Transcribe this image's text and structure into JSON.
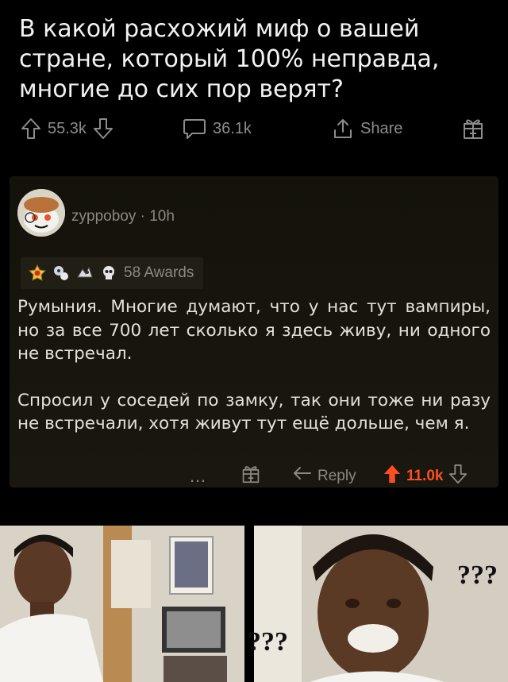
{
  "question": {
    "lines": [
      "В какой расхожий миф о вашей",
      "стране, который 100% неправда,",
      "многие до сих пор верят?"
    ]
  },
  "postbar": {
    "upvotes": "55.3k",
    "comments": "36.1k",
    "share_label": "Share"
  },
  "comment": {
    "author": "zyppoboy",
    "time": "10h",
    "awards_label": "58 Awards",
    "paragraphs": [
      "Румыния. Многие думают, что у нас тут вампиры, но за все 700 лет сколько я здесь живу, ни одного не встречал.",
      "Спросил у соседей по замку, так они тоже ни разу не встречали, хотя живут тут ещё дольше, чем я."
    ],
    "actions": {
      "more_label": "…",
      "reply_label": "Reply",
      "score": "11.0k"
    }
  },
  "meme": {
    "left_caption": "???",
    "right_caption": "???"
  },
  "colors": {
    "upvote_active": "#ff4f1f",
    "muted": "#8a8880",
    "comment_bg": "#16140d"
  }
}
